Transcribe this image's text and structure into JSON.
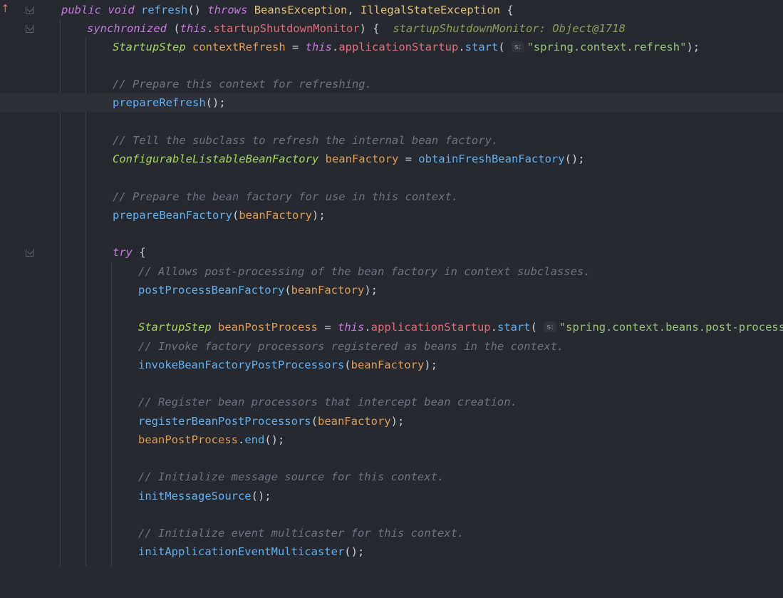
{
  "code": {
    "l1": {
      "kw1": "public",
      "kw2": "void",
      "fn": "refresh",
      "p1": "() ",
      "kw3": "throws",
      "cls1": "BeansException",
      "p2": ", ",
      "cls2": "IllegalStateException",
      "p3": " {"
    },
    "l2": {
      "kw": "synchronized",
      "p1": " (",
      "this": "this",
      "p2": ".",
      "field": "startupShutdownMonitor",
      "p3": ") {",
      "hint": "startupShutdownMonitor: Object@1718"
    },
    "l3": {
      "type": "StartupStep",
      "var": "contextRefresh",
      "p1": " = ",
      "this": "this",
      "p2": ".",
      "field": "applicationStartup",
      "p3": ".",
      "fn": "start",
      "p4": "(",
      "param": "s:",
      "str": "\"spring.context.refresh\"",
      "p5": ");"
    },
    "l4": {
      "cmt": "// Prepare this context for refreshing."
    },
    "l5": {
      "fn": "prepareRefresh",
      "p": "();"
    },
    "l6": {
      "cmt": "// Tell the subclass to refresh the internal bean factory."
    },
    "l7": {
      "type": "ConfigurableListableBeanFactory",
      "var": "beanFactory",
      "p1": " = ",
      "fn": "obtainFreshBeanFactory",
      "p2": "();"
    },
    "l8": {
      "cmt": "// Prepare the bean factory for use in this context."
    },
    "l9": {
      "fn": "prepareBeanFactory",
      "p1": "(",
      "var": "beanFactory",
      "p2": ");"
    },
    "l10": {
      "kw": "try",
      "p": " {"
    },
    "l11": {
      "cmt": "// Allows post-processing of the bean factory in context subclasses."
    },
    "l12": {
      "fn": "postProcessBeanFactory",
      "p1": "(",
      "var": "beanFactory",
      "p2": ");"
    },
    "l13": {
      "type": "StartupStep",
      "var": "beanPostProcess",
      "p1": " = ",
      "this": "this",
      "p2": ".",
      "field": "applicationStartup",
      "p3": ".",
      "fn": "start",
      "p4": "(",
      "param": "s:",
      "str": "\"spring.context.beans.post-process\"",
      "p5": ");"
    },
    "l14": {
      "cmt": "// Invoke factory processors registered as beans in the context."
    },
    "l15": {
      "fn": "invokeBeanFactoryPostProcessors",
      "p1": "(",
      "var": "beanFactory",
      "p2": ");"
    },
    "l16": {
      "cmt": "// Register bean processors that intercept bean creation."
    },
    "l17": {
      "fn": "registerBeanPostProcessors",
      "p1": "(",
      "var": "beanFactory",
      "p2": ");"
    },
    "l18": {
      "var": "beanPostProcess",
      "p1": ".",
      "fn": "end",
      "p2": "();"
    },
    "l19": {
      "cmt": "// Initialize message source for this context."
    },
    "l20": {
      "fn": "initMessageSource",
      "p": "();"
    },
    "l21": {
      "cmt": "// Initialize event multicaster for this context."
    },
    "l22": {
      "fn": "initApplicationEventMulticaster",
      "p": "();"
    }
  },
  "gutter": {
    "override_icon": "↑"
  },
  "colors": {
    "background": "#262930",
    "keyword": "#c678dd",
    "function": "#61afef",
    "class": "#e5c07b",
    "type": "#a6d65b",
    "variable": "#e09b55",
    "string": "#98c379",
    "comment": "#6b7280"
  }
}
